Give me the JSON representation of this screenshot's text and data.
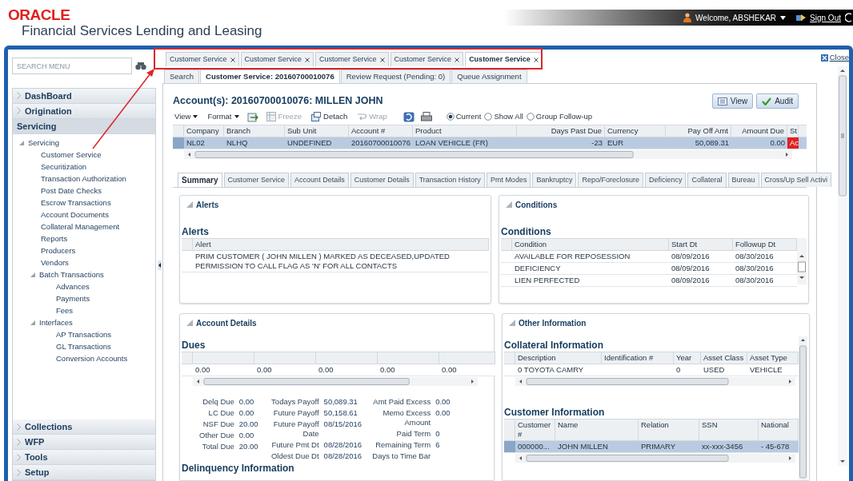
{
  "header": {
    "logo": "ORACLE",
    "product": "Financial Services Lending and Leasing",
    "welcome": "Welcome, ABSHEKAR",
    "sign_out": "Sign Out"
  },
  "sidebar": {
    "search_placeholder": "SEARCH MENU",
    "sections": [
      {
        "label": "DashBoard",
        "expanded": false
      },
      {
        "label": "Origination",
        "expanded": false
      },
      {
        "label": "Servicing",
        "expanded": true,
        "tree": [
          {
            "label": "Servicing",
            "expanded": true,
            "children": [
              {
                "label": "Customer Service"
              },
              {
                "label": "Securitization"
              },
              {
                "label": "Transaction Authorization"
              },
              {
                "label": "Post Date Checks"
              },
              {
                "label": "Escrow Transactions"
              },
              {
                "label": "Account Documents"
              },
              {
                "label": "Collateral Management"
              },
              {
                "label": "Reports"
              },
              {
                "label": "Producers"
              },
              {
                "label": "Vendors"
              },
              {
                "label": "Batch Transactions",
                "expanded": true,
                "children": [
                  {
                    "label": "Advances"
                  },
                  {
                    "label": "Payments"
                  },
                  {
                    "label": "Fees"
                  }
                ]
              },
              {
                "label": "Interfaces",
                "expanded": true,
                "children": [
                  {
                    "label": "AP Transactions"
                  },
                  {
                    "label": "GL Transactions"
                  },
                  {
                    "label": "Conversion Accounts"
                  }
                ]
              }
            ]
          }
        ]
      },
      {
        "label": "Collections",
        "expanded": false
      },
      {
        "label": "WFP",
        "expanded": false
      },
      {
        "label": "Tools",
        "expanded": false
      },
      {
        "label": "Setup",
        "expanded": false
      }
    ]
  },
  "doc_tabs": [
    {
      "label": "Customer Service",
      "selected": false
    },
    {
      "label": "Customer Service",
      "selected": false
    },
    {
      "label": "Customer Service",
      "selected": false
    },
    {
      "label": "Customer Service",
      "selected": false
    },
    {
      "label": "Customer Service",
      "selected": true
    }
  ],
  "close_link": "Close",
  "sub_tabs": [
    {
      "label": "Search",
      "selected": false
    },
    {
      "label": "Customer Service: 20160700010076",
      "selected": true
    },
    {
      "label": "Review Request (Pending: 0)",
      "selected": false
    },
    {
      "label": "Queue Assignment",
      "selected": false
    }
  ],
  "account": {
    "title": "Account(s): 20160700010076: MILLEN JOHN",
    "buttons": [
      {
        "kind": "view",
        "label": "View"
      },
      {
        "kind": "audit",
        "label": "Audit"
      }
    ],
    "menus": [
      "View",
      "Format"
    ],
    "actions": [
      {
        "kind": "freeze",
        "label": "Freeze",
        "disabled": true
      },
      {
        "kind": "detach",
        "label": "Detach",
        "disabled": false
      },
      {
        "kind": "wrap",
        "label": "Wrap",
        "disabled": true
      }
    ],
    "radios": [
      {
        "label": "Current",
        "selected": true
      },
      {
        "label": "Show All",
        "selected": false
      },
      {
        "label": "Group Follow-up",
        "selected": false
      }
    ],
    "table": {
      "columns": [
        "Company",
        "Branch",
        "Sub Unit",
        "Account #",
        "Product",
        "Days Past Due",
        "Currency",
        "Pay Off Amt",
        "Amount Due",
        "St"
      ],
      "rows": [
        {
          "cells": [
            "NL02",
            "NLHQ",
            "UNDEFINED",
            "20160700010076",
            "LOAN VEHICLE (FR)",
            "-23",
            "EUR",
            "50,089.31",
            "0.00",
            "Ac"
          ],
          "selected": true
        }
      ]
    }
  },
  "detail_tabs": [
    {
      "label": "Summary",
      "selected": true
    },
    {
      "label": "Customer Service",
      "selected": false
    },
    {
      "label": "Account Details",
      "selected": false
    },
    {
      "label": "Customer Details",
      "selected": false
    },
    {
      "label": "Transaction History",
      "selected": false
    },
    {
      "label": "Pmt Modes",
      "selected": false
    },
    {
      "label": "Bankruptcy",
      "selected": false
    },
    {
      "label": "Repo/Foreclosure",
      "selected": false
    },
    {
      "label": "Deficiency",
      "selected": false
    },
    {
      "label": "Collateral",
      "selected": false
    },
    {
      "label": "Bureau",
      "selected": false
    },
    {
      "label": "Cross/Up Sell Activi",
      "selected": false
    }
  ],
  "alerts": {
    "panel_title": "Alerts",
    "heading": "Alerts",
    "columns": [
      "Alert"
    ],
    "rows": [
      {
        "cells": [
          "PRIM CUSTOMER ( JOHN MILLEN ) MARKED AS DECEASED,UPDATED PERMISSION TO CALL FLAG AS 'N' FOR ALL CONTACTS"
        ]
      }
    ]
  },
  "conditions": {
    "panel_title": "Conditions",
    "heading": "Conditions",
    "columns": [
      "Condition",
      "Start Dt",
      "Followup Dt"
    ],
    "rows": [
      {
        "cells": [
          "AVAILABLE FOR REPOSESSION",
          "08/09/2016",
          "08/30/2016"
        ]
      },
      {
        "cells": [
          "DEFICIENCY",
          "08/09/2016",
          "08/30/2016"
        ]
      },
      {
        "cells": [
          "LIEN PERFECTED",
          "08/09/2016",
          "08/30/2016"
        ]
      }
    ]
  },
  "account_details": {
    "panel_title": "Account Details",
    "heading": "Dues",
    "dues_rows": [
      {
        "cells": [
          "0.00",
          "0.00",
          "0.00",
          "0.00",
          "0.00"
        ]
      }
    ],
    "fields": [
      [
        {
          "label": "Delq Due",
          "value": "0.00"
        },
        {
          "label": "LC Due",
          "value": "0.00"
        },
        {
          "label": "NSF Due",
          "value": "20.00"
        },
        {
          "label": "Other Due",
          "value": "0.00"
        },
        {
          "label": "Total Due",
          "value": "20.00"
        }
      ],
      [
        {
          "label": "Todays Payoff",
          "value": "50,089.31"
        },
        {
          "label": "Future Payoff",
          "value": "50,158.61"
        },
        {
          "label": "Future Payoff Date",
          "value": "08/15/2016"
        },
        {
          "label": "Future Pmt Dt",
          "value": "08/28/2016"
        },
        {
          "label": "Oldest Due Dt",
          "value": "08/28/2016"
        }
      ],
      [
        {
          "label": "Amt Paid Excess",
          "value": "0.00"
        },
        {
          "label": "Memo Excess Amount",
          "value": "0.00"
        },
        {
          "label": "Paid Term",
          "value": "0"
        },
        {
          "label": "Remaining Term",
          "value": "6"
        },
        {
          "label": "Days to Time Bar"
        }
      ]
    ],
    "next_heading": "Delinquency Information"
  },
  "other_information": {
    "panel_title": "Other Information",
    "collateral": {
      "heading": "Collateral Information",
      "columns": [
        "Description",
        "Identification #",
        "Year",
        "Asset Class",
        "Asset Type"
      ],
      "rows": [
        {
          "cells": [
            "0 TOYOTA CAMRY",
            "",
            "0",
            "USED",
            "VEHICLE"
          ],
          "selected": false
        }
      ]
    },
    "customers": {
      "heading": "Customer Information",
      "columns": [
        "Customer #",
        "Name",
        "Relation",
        "SSN",
        "National"
      ],
      "rows": [
        {
          "cells": [
            "000000...",
            "JOHN MILLEN",
            "PRIMARY",
            "xx-xxx-3456",
            "- 45-678"
          ],
          "selected": true
        }
      ]
    }
  }
}
